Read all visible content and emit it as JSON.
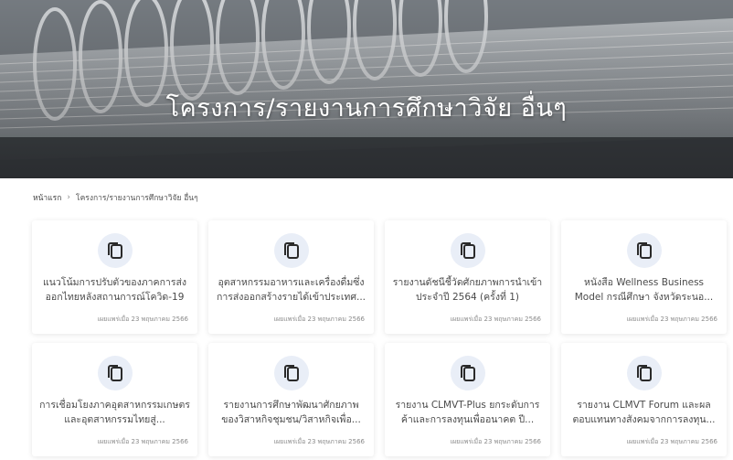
{
  "hero": {
    "title": "โครงการ/รายงานการศึกษาวิจัย อื่นๆ"
  },
  "breadcrumb": {
    "home": "หน้าแรก",
    "separator": "›",
    "current": "โครงการ/รายงานการศึกษาวิจัย อื่นๆ"
  },
  "cards": [
    {
      "icon": "document-icon",
      "title": "แนวโน้มการปรับตัวของภาคการส่งออกไทยหลังสถานการณ์โควิด-19",
      "date": "เผยแพร่เมื่อ 23 พฤษภาคม 2566"
    },
    {
      "icon": "document-icon",
      "title": "อุตสาหกรรมอาหารและเครื่องดื่มซึ่งการส่งออกสร้างรายได้เข้าประเทศ...",
      "date": "เผยแพร่เมื่อ 23 พฤษภาคม 2566"
    },
    {
      "icon": "document-icon",
      "title": "รายงานดัชนีชี้วัดศักยภาพการนำเข้า ประจำปี 2564 (ครั้งที่ 1)",
      "date": "เผยแพร่เมื่อ 23 พฤษภาคม 2566"
    },
    {
      "icon": "document-icon",
      "title": "หนังสือ Wellness Business Model กรณีศึกษา จังหวัดระนอ...",
      "date": "เผยแพร่เมื่อ 23 พฤษภาคม 2566"
    },
    {
      "icon": "document-icon",
      "title": "การเชื่อมโยงภาคอุตสาหกรรมเกษตรและอุตสาหกรรมไทยสู่...",
      "date": "เผยแพร่เมื่อ 23 พฤษภาคม 2566"
    },
    {
      "icon": "document-icon",
      "title": "รายงานการศึกษาพัฒนาศักยภาพของวิสาหกิจชุมชน/วิสาหกิจเพื่อ...",
      "date": "เผยแพร่เมื่อ 23 พฤษภาคม 2566"
    },
    {
      "icon": "document-icon",
      "title": "รายงาน CLMVT-Plus ยกระดับการค้าและการลงทุนเพื่ออนาคต ปี...",
      "date": "เผยแพร่เมื่อ 23 พฤษภาคม 2566"
    },
    {
      "icon": "document-icon",
      "title": "รายงาน CLMVT Forum และผลตอบแทนทางสังคมจากการลงทุน...",
      "date": "เผยแพร่เมื่อ 23 พฤษภาคม 2566"
    }
  ],
  "colors": {
    "icon_bg": "#e9eef7",
    "icon_stroke": "#2a2a2a"
  }
}
